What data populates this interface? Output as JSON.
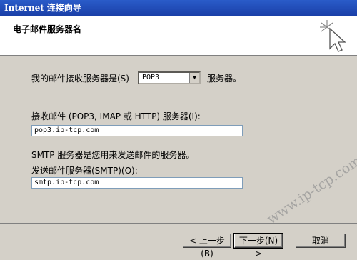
{
  "window": {
    "title": "Internet 连接向导"
  },
  "header": {
    "title": "电子邮件服务器名"
  },
  "incoming_server_type": {
    "label": "我的邮件接收服务器是(S)",
    "selected": "POP3",
    "suffix": "服务器。"
  },
  "incoming_server": {
    "label": "接收邮件 (POP3, IMAP 或 HTTP) 服务器(I):",
    "value": "pop3.ip-tcp.com"
  },
  "smtp_note": "SMTP 服务器是您用来发送邮件的服务器。",
  "outgoing_server": {
    "label": "发送邮件服务器(SMTP)(O):",
    "value": "smtp.ip-tcp.com"
  },
  "buttons": {
    "back": "< 上一步(B)",
    "next": "下一步(N) >",
    "cancel": "取消"
  },
  "watermark": "www.ip-tcp.com"
}
